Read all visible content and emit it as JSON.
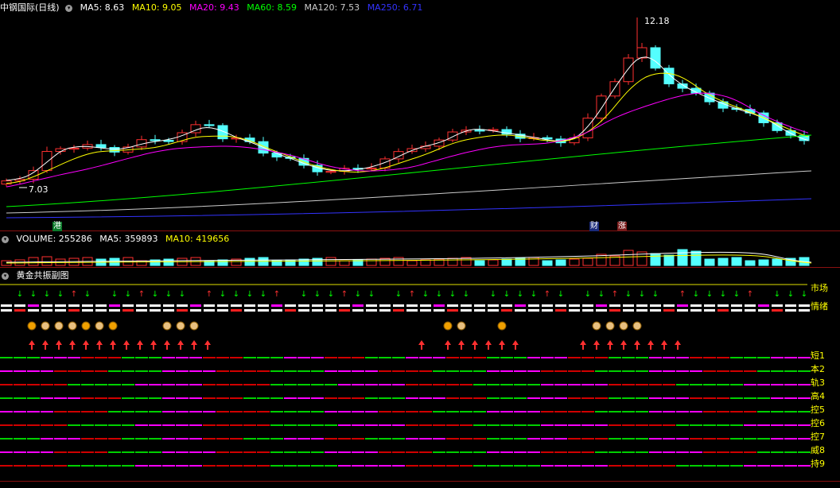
{
  "price_legend": {
    "title": "中钢国际(日线)",
    "toggle_icon": "circle-chevron-icon",
    "items": [
      {
        "text": "MA5: 8.63",
        "color": "#ffffff"
      },
      {
        "text": "MA10: 9.05",
        "color": "#ffff00"
      },
      {
        "text": "MA20: 9.43",
        "color": "#ff00ff"
      },
      {
        "text": "MA60: 8.59",
        "color": "#00ff00"
      },
      {
        "text": "MA120: 7.53",
        "color": "#cccccc"
      },
      {
        "text": "MA250: 6.71",
        "color": "#3333ff"
      }
    ]
  },
  "price_notes": {
    "high": "12.18",
    "low": "7.03"
  },
  "badges": [
    {
      "text": "港",
      "bg": "#0a7a2a",
      "fg": "#ffffff"
    },
    {
      "text": "财",
      "bg": "#1a2a7a",
      "fg": "#ffffff"
    },
    {
      "text": "涨",
      "bg": "#7a1a1a",
      "fg": "#ffffff"
    }
  ],
  "volume_legend": {
    "title": "VOLUME: 255286",
    "items": [
      {
        "text": "MA5: 359893",
        "color": "#ffffff"
      },
      {
        "text": "MA10: 419656",
        "color": "#ffff00"
      }
    ]
  },
  "indicator_legend": {
    "title": "黄金共振副图"
  },
  "indicator_labels": [
    "市场",
    "情绪",
    "短1",
    "本2",
    "轨3",
    "高4",
    "控5",
    "控6",
    "控7",
    "威8",
    "持9"
  ],
  "colors": {
    "up": "#ff3030",
    "down": "#54ffff",
    "grid": "#8a1010"
  },
  "chart_data": {
    "type": "candlestick",
    "price_high_label": 12.18,
    "price_low_label": 7.03,
    "ma": {
      "MA5": 8.63,
      "MA10": 9.05,
      "MA20": 9.43,
      "MA60": 8.59,
      "MA120": 7.53,
      "MA250": 6.71
    },
    "volume": 255286,
    "volume_ma": {
      "MA5": 359893,
      "MA10": 419656
    }
  }
}
